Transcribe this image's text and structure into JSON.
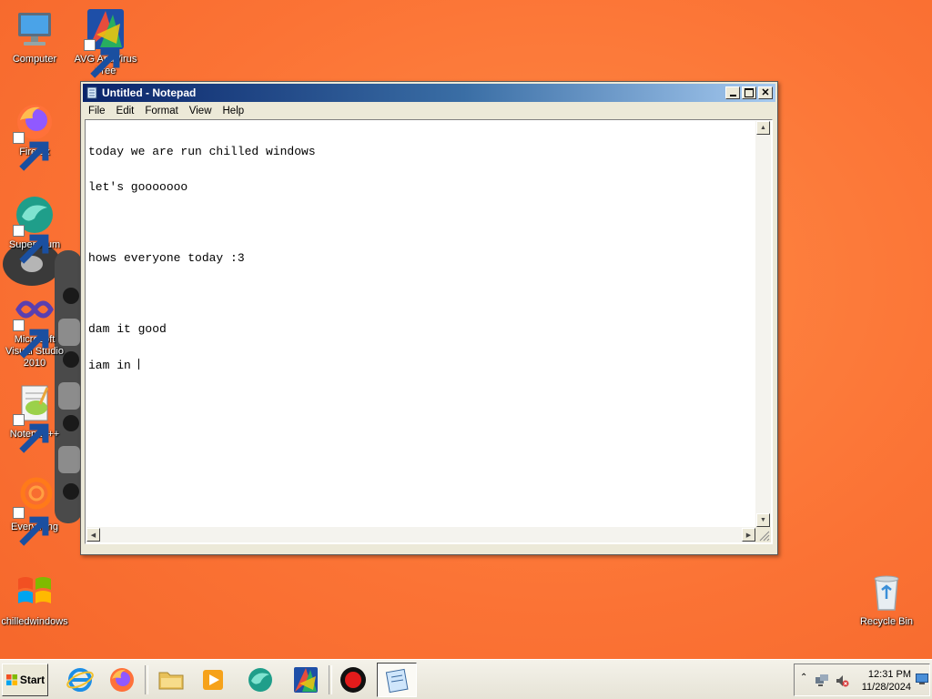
{
  "desktop": {
    "icons": [
      {
        "label": "Computer",
        "icon": "computer-icon"
      },
      {
        "label": "AVG AntiVirus Free",
        "icon": "avg-icon"
      },
      {
        "label": "Firefox",
        "icon": "firefox-icon"
      },
      {
        "label": "Supermium",
        "icon": "supermium-icon"
      },
      {
        "label": "Microsoft Visual Studio 2010",
        "icon": "visual-studio-icon"
      },
      {
        "label": "Notepad++",
        "icon": "notepadpp-icon"
      },
      {
        "label": "Everything",
        "icon": "everything-icon"
      },
      {
        "label": "chilledwindows",
        "icon": "windows-flag-icon"
      },
      {
        "label": "Recycle Bin",
        "icon": "recycle-bin-icon"
      }
    ]
  },
  "notepad": {
    "title": "Untitled - Notepad",
    "menu": [
      "File",
      "Edit",
      "Format",
      "View",
      "Help"
    ],
    "lines": [
      "today we are run chilled windows",
      "let's gooooooo",
      "",
      "hows everyone today :3",
      "",
      "dam it good",
      "iam in "
    ]
  },
  "taskbar": {
    "start_label": "Start",
    "apps": [
      "internet-explorer-icon",
      "firefox-icon",
      "file-explorer-icon",
      "media-player-icon",
      "supermium-icon",
      "avg-icon",
      "record-icon",
      "notepad-icon"
    ],
    "clock": {
      "time": "12:31 PM",
      "date": "11/28/2024"
    }
  },
  "colors": {
    "desktop": "#fb7335",
    "titlebar_start": "#0a246a",
    "titlebar_end": "#a6caf0",
    "window_face": "#ece9d8"
  }
}
